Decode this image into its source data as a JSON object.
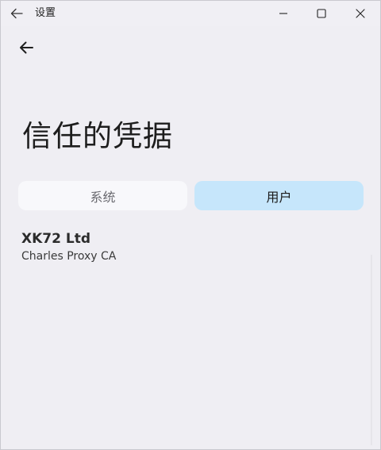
{
  "window": {
    "title": "设置",
    "icons": {
      "back": "arrow-left-icon",
      "minimize": "minimize-icon",
      "maximize": "maximize-icon",
      "close": "close-icon"
    }
  },
  "page": {
    "title": "信任的凭据",
    "back_icon": "arrow-left-icon"
  },
  "tabs": [
    {
      "label": "系统",
      "selected": false
    },
    {
      "label": "用户",
      "selected": true
    }
  ],
  "credentials": [
    {
      "title": "XK72 Ltd",
      "subtitle": "Charles Proxy CA"
    }
  ],
  "colors": {
    "background": "#efeef3",
    "selected_tab": "#c6e6fb",
    "unselected_tab": "#f8f8fb"
  }
}
